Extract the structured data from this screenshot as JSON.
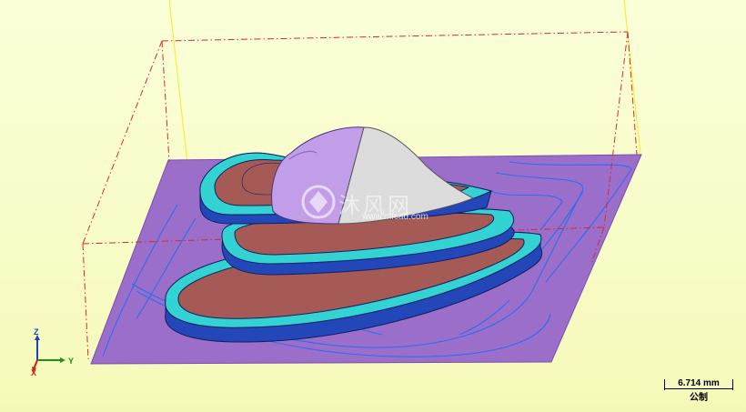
{
  "viewport": {
    "background_top": "#fbffd9",
    "background_bottom": "#f5f9b8"
  },
  "colors": {
    "stock_plane": "#9a6ec9",
    "toolpath": "#2b6df2",
    "terrace_top": "#a55a55",
    "fillet": "#33d3d3",
    "wall": "#2346b8",
    "dome_purple": "#c39ee8",
    "dome_grey": "#dcdcdc",
    "bounding_box": "#d92a2a",
    "work_axis": "#f2f23a"
  },
  "triad": {
    "z_label": "Z",
    "y_label": "Y",
    "x_label": "X"
  },
  "scale_bar": {
    "value": "6.714 mm",
    "units": "公制"
  },
  "watermark": {
    "text": "沐风网",
    "url": "www.mfcad.com"
  }
}
